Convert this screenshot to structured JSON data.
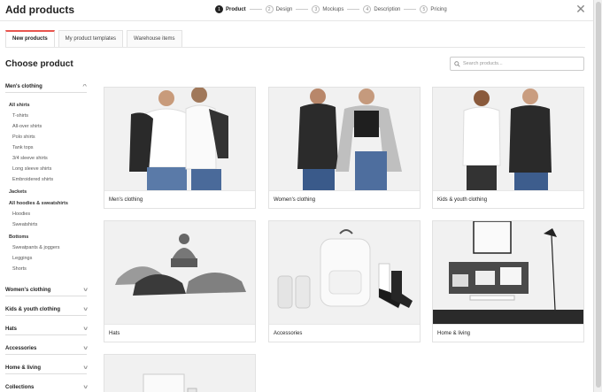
{
  "header": {
    "title": "Add products",
    "steps": [
      {
        "num": "1",
        "label": "Product"
      },
      {
        "num": "2",
        "label": "Design"
      },
      {
        "num": "3",
        "label": "Mockups"
      },
      {
        "num": "4",
        "label": "Description"
      },
      {
        "num": "5",
        "label": "Pricing"
      }
    ],
    "close_icon": "close-icon"
  },
  "tabs": [
    {
      "label": "New products"
    },
    {
      "label": "My product templates"
    },
    {
      "label": "Warehouse items"
    }
  ],
  "accent_color": "#e8554e",
  "main": {
    "heading": "Choose product",
    "search_placeholder": "Search products..."
  },
  "sidebar": {
    "mens": {
      "label": "Men's clothing",
      "all_shirts": "All shirts",
      "shirts": [
        "T-shirts",
        "All-over shirts",
        "Polo shirts",
        "Tank tops",
        "3/4 sleeve shirts",
        "Long sleeve shirts",
        "Embroidered shirts"
      ],
      "jackets": "Jackets",
      "hoodies_title": "All hoodies & sweatshirts",
      "hoodies": [
        "Hoodies",
        "Sweatshirts"
      ],
      "bottoms_title": "Bottoms",
      "bottoms": [
        "Sweatpants & joggers",
        "Leggings",
        "Shorts"
      ]
    },
    "categories": [
      "Women's clothing",
      "Kids & youth clothing",
      "Hats",
      "Accessories",
      "Home & living",
      "Collections"
    ]
  },
  "products": [
    {
      "label": "Men's clothing"
    },
    {
      "label": "Women's clothing"
    },
    {
      "label": "Kids & youth clothing"
    },
    {
      "label": "Hats"
    },
    {
      "label": "Accessories"
    },
    {
      "label": "Home & living"
    }
  ]
}
